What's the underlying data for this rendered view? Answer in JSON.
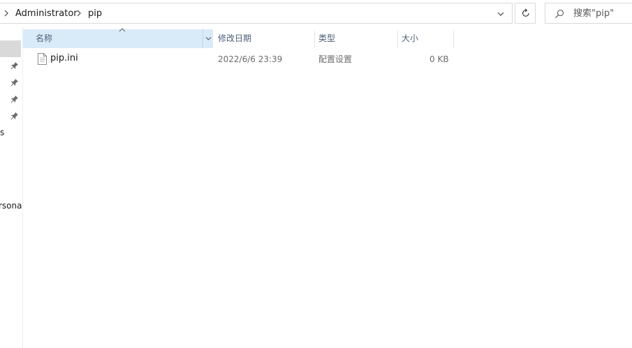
{
  "breadcrumb": {
    "items": [
      "Administrator",
      "pip"
    ]
  },
  "search": {
    "placeholder": "搜索\"pip\""
  },
  "nav": {
    "partial_labels": [
      "s",
      "rsona"
    ]
  },
  "columns": {
    "name": "名称",
    "modified": "修改日期",
    "type": "类型",
    "size": "大小"
  },
  "files": [
    {
      "name": "pip.ini",
      "modified": "2022/6/6 23:39",
      "type": "配置设置",
      "size": "0 KB"
    }
  ],
  "colors": {
    "header_selected": "#d9ebf9",
    "nav_selected": "#d9d9d9",
    "border": "#d9d9d9"
  },
  "icons": [
    "chevron-right-icon",
    "chevron-down-icon",
    "refresh-icon",
    "search-icon",
    "pin-icon",
    "sort-up-icon",
    "file-icon"
  ]
}
